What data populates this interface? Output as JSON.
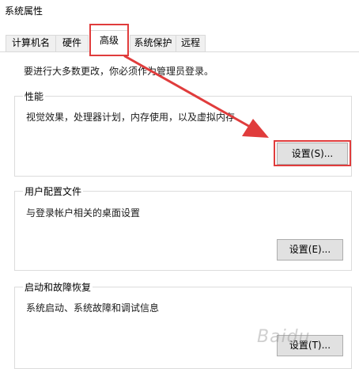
{
  "window": {
    "title": "系统属性"
  },
  "tabs": [
    {
      "label": "计算机名"
    },
    {
      "label": "硬件"
    },
    {
      "label": "高级"
    },
    {
      "label": "系统保护"
    },
    {
      "label": "远程"
    }
  ],
  "notice": "要进行大多数更改，你必须作为管理员登录。",
  "performance": {
    "title": "性能",
    "description": "视觉效果，处理器计划，内存使用，以及虚拟内存",
    "button": "设置(S)..."
  },
  "user_profiles": {
    "title": "用户配置文件",
    "description": "与登录帐户相关的桌面设置",
    "button": "设置(E)..."
  },
  "startup_recovery": {
    "title": "启动和故障恢复",
    "description": "系统启动、系统故障和调试信息",
    "button": "设置(T)..."
  },
  "annotation": {
    "color": "#e03c3c"
  },
  "watermark": "Baidu"
}
